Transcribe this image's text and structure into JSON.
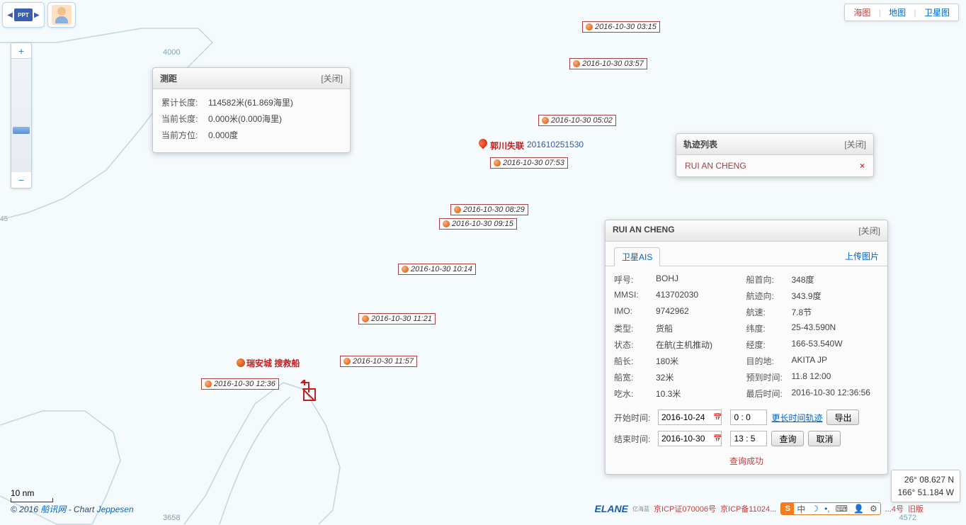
{
  "maptype": {
    "chart": "海图",
    "map": "地图",
    "sat": "卫星图"
  },
  "toolbar": {
    "ppt": "PPT"
  },
  "measure": {
    "title": "测距",
    "close": "[关闭]",
    "rows": {
      "total_len_label": "累计长度:",
      "total_len_value": "114582米(61.869海里)",
      "cur_len_label": "当前长度:",
      "cur_len_value": "0.000米(0.000海里)",
      "cur_brg_label": "当前方位:",
      "cur_brg_value": "0.000度"
    }
  },
  "tracklist": {
    "title": "轨迹列表",
    "close": "[关闭]",
    "item": "RUI AN CHENG"
  },
  "ship": {
    "title": "RUI AN CHENG",
    "close": "[关闭]",
    "tab_ais": "卫星AIS",
    "upload": "上传图片",
    "fields": {
      "callsign_l": "呼号:",
      "callsign_v": "BOHJ",
      "hdg_l": "船首向:",
      "hdg_v": "348度",
      "mmsi_l": "MMSI:",
      "mmsi_v": "413702030",
      "cog_l": "航迹向:",
      "cog_v": "343.9度",
      "imo_l": "IMO:",
      "imo_v": "9742962",
      "sog_l": "航速:",
      "sog_v": "7.8节",
      "type_l": "类型:",
      "type_v": "货船",
      "lat_l": "纬度:",
      "lat_v": "25-43.590N",
      "state_l": "状态:",
      "state_v": "在航(主机推动)",
      "lon_l": "经度:",
      "lon_v": "166-53.540W",
      "len_l": "船长:",
      "len_v": "180米",
      "dest_l": "目的地:",
      "dest_v": "AKITA JP",
      "beam_l": "船宽:",
      "beam_v": "32米",
      "eta_l": "预到时间:",
      "eta_v": "11.8 12:00",
      "draft_l": "吃水:",
      "draft_v": "10.3米",
      "last_l": "最后时间:",
      "last_v": "2016-10-30 12:36:56"
    },
    "query": {
      "start_l": "开始时间:",
      "start_date": "2016-10-24",
      "start_time": "0 : 0",
      "end_l": "结束时间:",
      "end_date": "2016-10-30",
      "end_time": "13 : 5",
      "extend": "更长时间轨迹",
      "export": "导出",
      "search": "查询",
      "cancel": "取消",
      "status": "查询成功"
    }
  },
  "coord": {
    "lat": "26° 08.627 N",
    "lon": "166° 51.184 W"
  },
  "scale": "10 nm",
  "copyright": {
    "text_pre": "© 2016 ",
    "site": "船讯网",
    "text_mid": " - Chart ",
    "jeppesen": "Jeppesen"
  },
  "footer": {
    "elane": "ELANE",
    "elane_sub": "亿海蓝",
    "icp1": "京ICP证070006号",
    "icp2": "京ICP备11024...",
    "num": "...4号",
    "oldver": "旧版",
    "depth_right": "4572",
    "ime_zhong": "中"
  },
  "poi": {
    "rescue": "瑞安城 搜救船",
    "guochuan": "郭川失联",
    "guochuan_time": "201610251530"
  },
  "depth": {
    "d4000": "4000",
    "d3658": "3658",
    "m45": "45"
  },
  "timestamps": [
    {
      "t": "2016-10-30 03:15"
    },
    {
      "t": "2016-10-30 03:57"
    },
    {
      "t": "2016-10-30 05:02"
    },
    {
      "t": "2016-10-30 07:53"
    },
    {
      "t": "2016-10-30 08:29"
    },
    {
      "t": "2016-10-30 09:15"
    },
    {
      "t": "2016-10-30 10:14"
    },
    {
      "t": "2016-10-30 11:21"
    },
    {
      "t": "2016-10-30 11:57"
    },
    {
      "t": "2016-10-30 12:36"
    }
  ]
}
